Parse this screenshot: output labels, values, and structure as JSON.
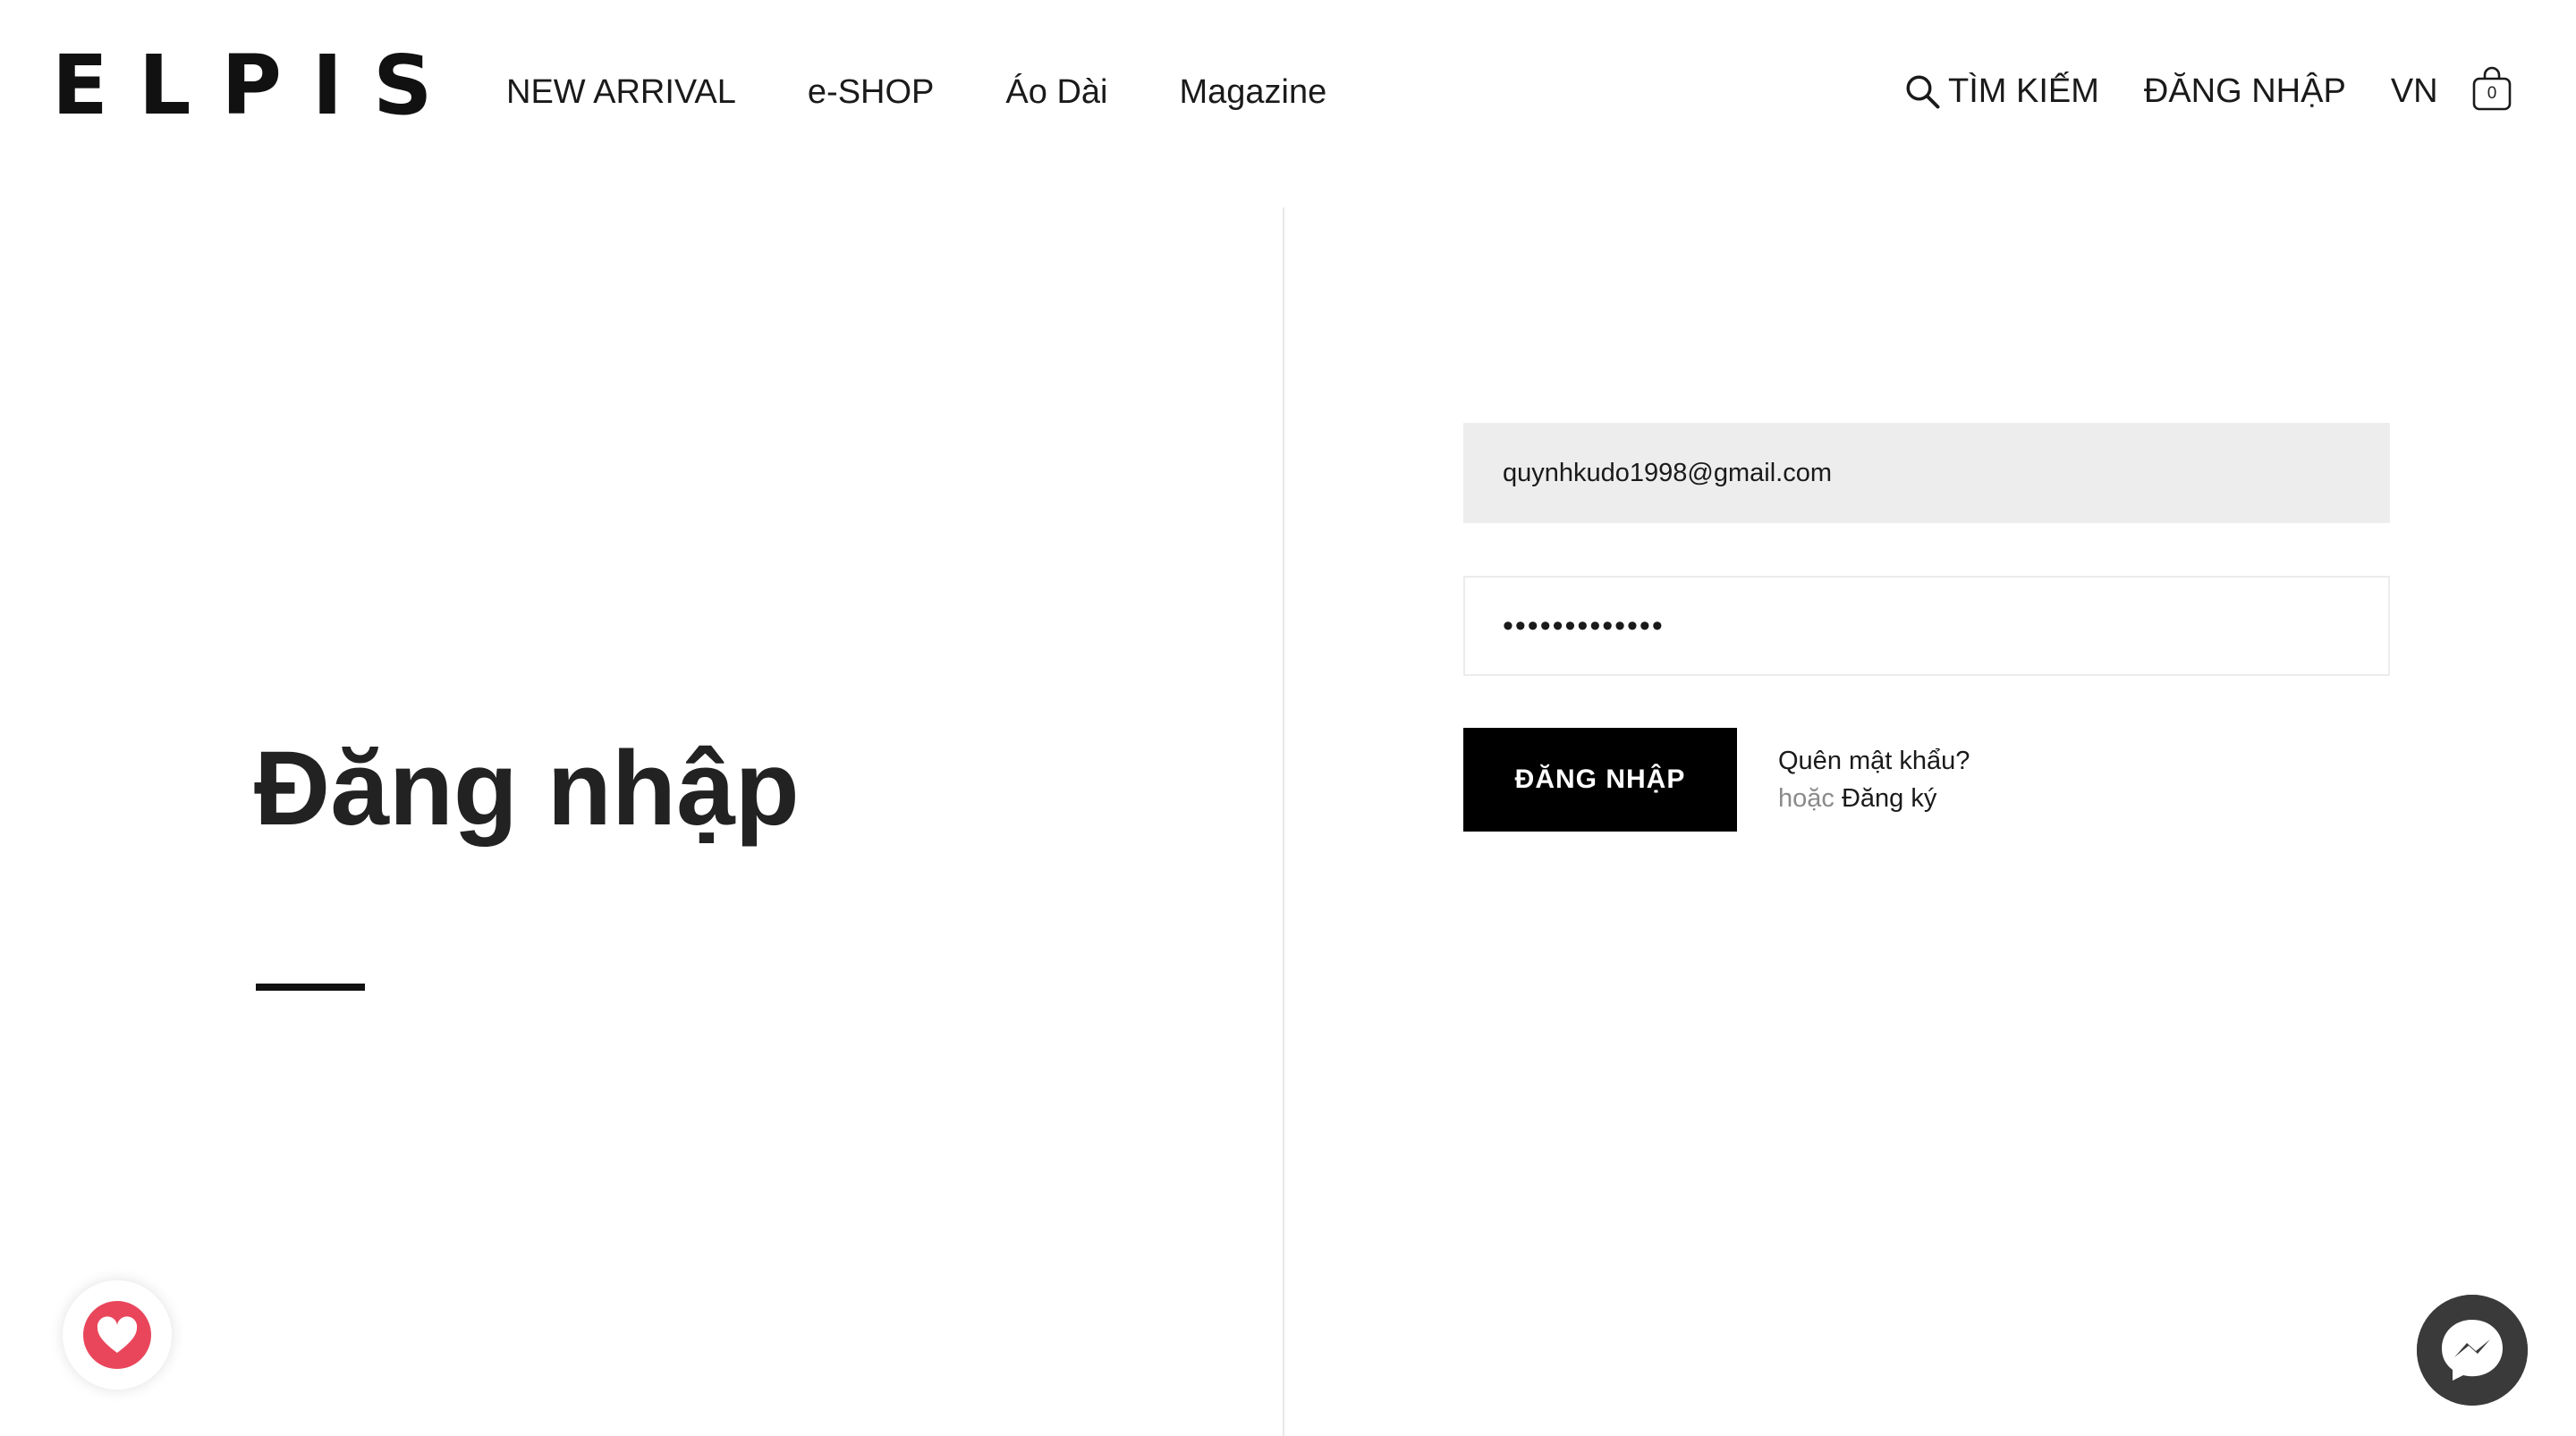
{
  "header": {
    "logo_text": "ELPIS",
    "nav": [
      {
        "label": "NEW ARRIVAL"
      },
      {
        "label": "e-SHOP"
      },
      {
        "label": "Áo Dài"
      },
      {
        "label": "Magazine"
      }
    ],
    "search_label": "TÌM KIẾM",
    "login_label": "ĐĂNG NHẬP",
    "language": "VN",
    "cart_count": "0"
  },
  "main": {
    "title": "Đăng nhập",
    "form": {
      "email_value": "quynhkudo1998@gmail.com",
      "password_value": "•••••••••••••",
      "submit_label": "ĐĂNG NHẬP",
      "forgot_label": "Quên mật khẩu?",
      "or_text": "hoặc",
      "register_label": "Đăng ký"
    }
  },
  "widgets": {
    "favorite_icon": "heart-icon",
    "chat_icon": "messenger-icon",
    "heart_color": "#e9465c"
  }
}
